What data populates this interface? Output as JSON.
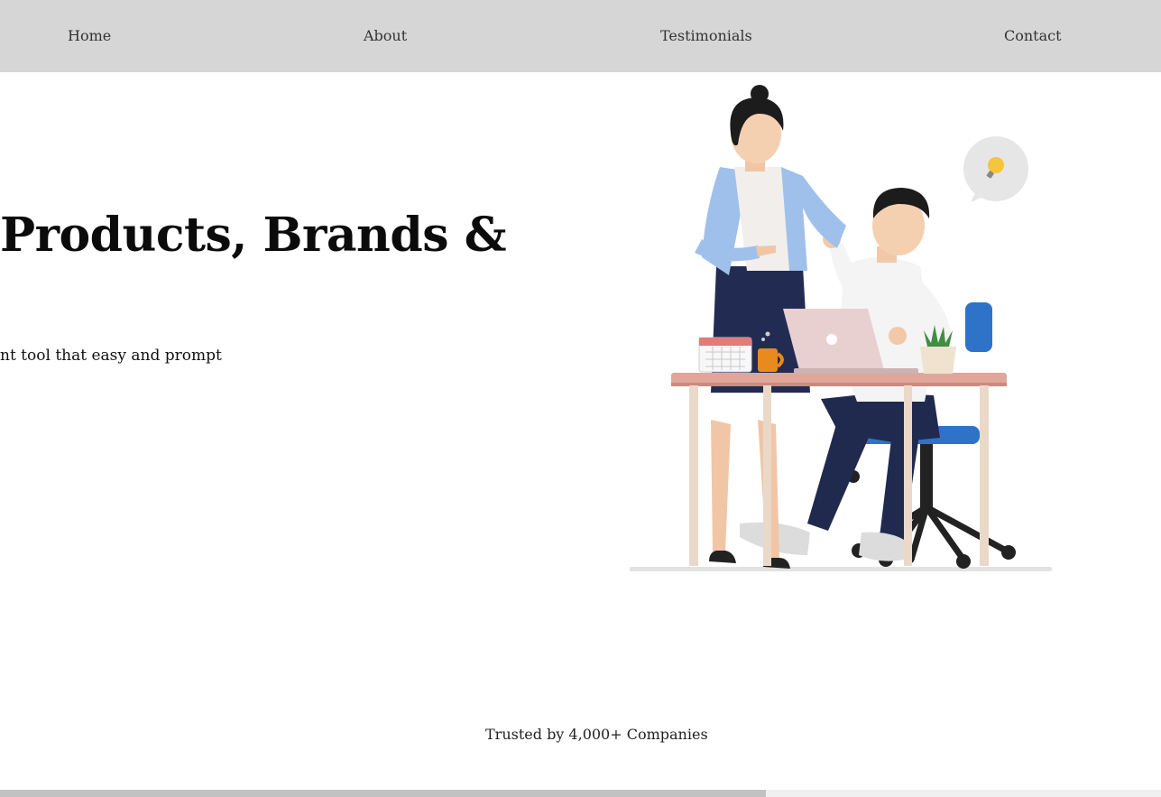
{
  "nav": {
    "items": [
      "Home",
      "About",
      "Testimonials",
      "Contact"
    ]
  },
  "hero": {
    "title": "Products, Brands &",
    "subtitle": "nt tool that easy and prompt",
    "illustration_icon": "office-workers-illustration"
  },
  "trusted": {
    "text": "Trusted by 4,000+ Companies"
  },
  "colors": {
    "nav_bg": "#d6d6d6",
    "page_bg": "#ffffff",
    "scroll_thumb": "#c2c2c2"
  },
  "scrollbar": {
    "position_fraction": 0.66
  }
}
